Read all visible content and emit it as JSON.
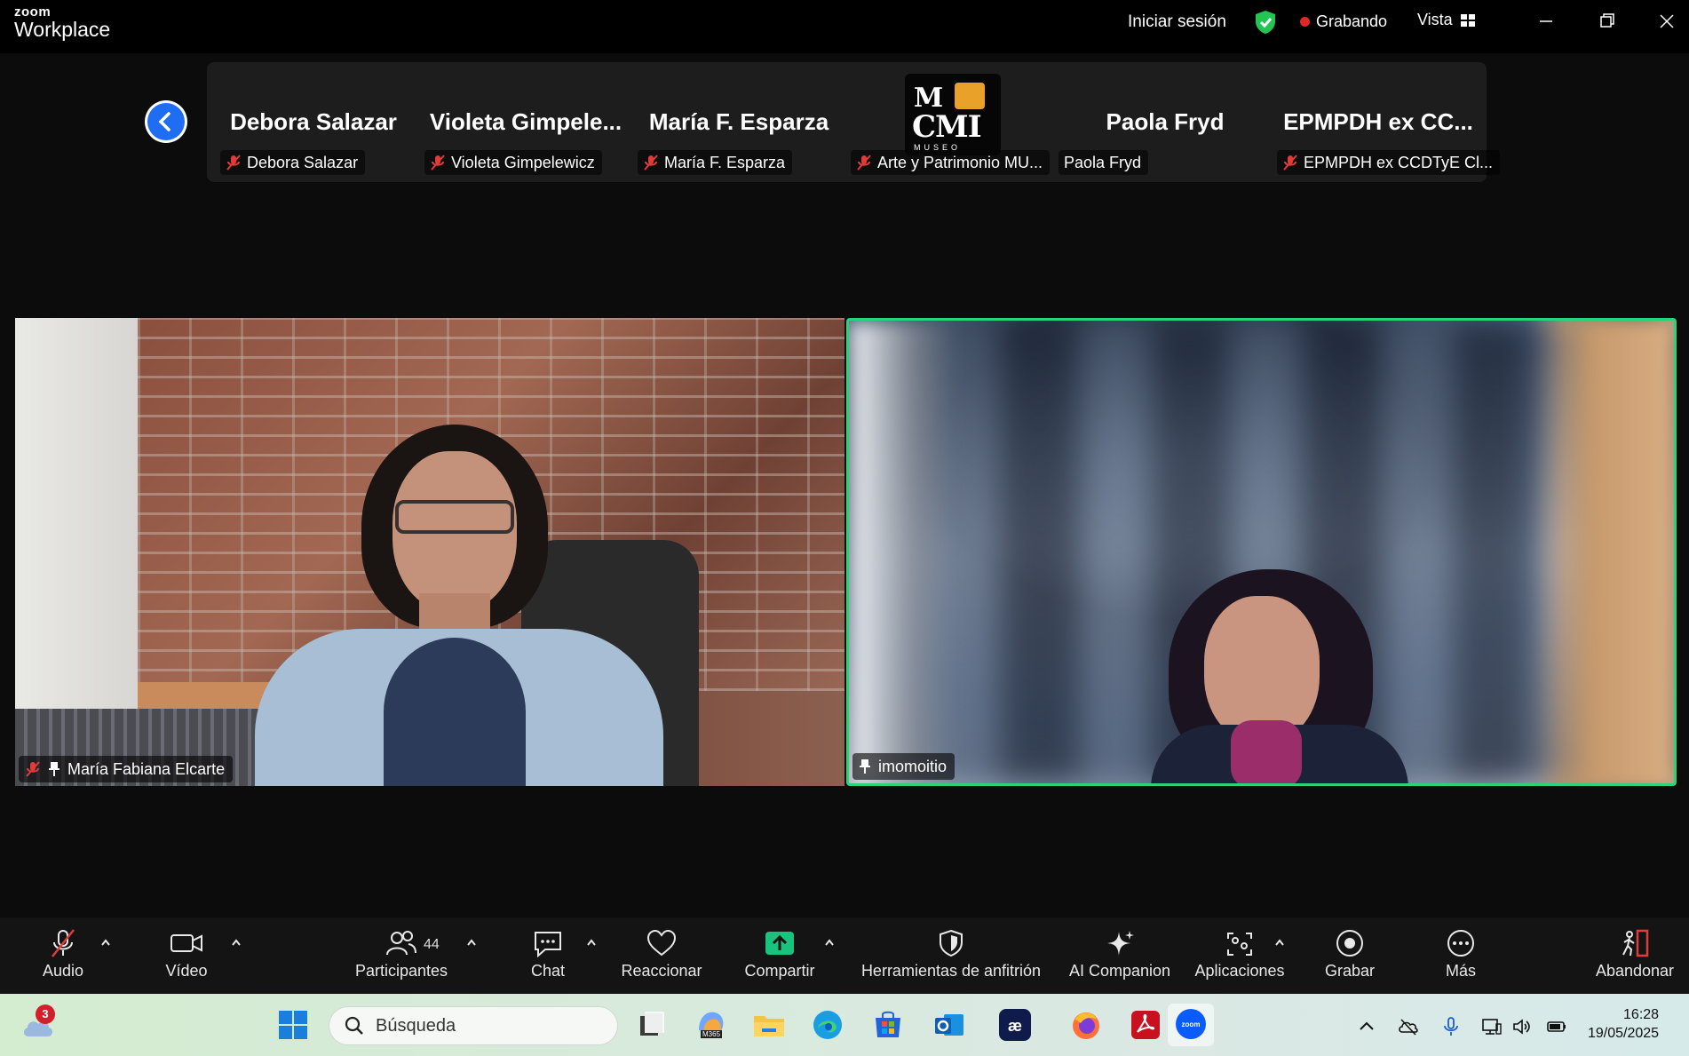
{
  "app": {
    "brand_small": "zoom",
    "brand_large": "Workplace"
  },
  "titlebar": {
    "signin": "Iniciar sesión",
    "recording": "Grabando",
    "view": "Vista"
  },
  "strip": {
    "tiles": [
      {
        "bigname": "Debora Salazar",
        "label": "Debora Salazar",
        "muted": true
      },
      {
        "bigname": "Violeta  Gimpele...",
        "label": "Violeta Gimpelewicz",
        "muted": true
      },
      {
        "bigname": "María F. Esparza",
        "label": "María F. Esparza",
        "muted": true
      },
      {
        "bigname": "",
        "label": "Arte y Patrimonio MU...",
        "muted": true
      },
      {
        "bigname": "Paola Fryd",
        "label": "Paola Fryd",
        "muted": false
      },
      {
        "bigname": "EPMPDH  ex  CC...",
        "label": "EPMPDH ex CCDTyE Cl...",
        "muted": true
      }
    ],
    "logo_tile": {
      "line1": "M",
      "line2": "CMI",
      "line3": "MUSEO"
    }
  },
  "videos": {
    "left": {
      "name": "María Fabiana Elcarte"
    },
    "right": {
      "name": "imomoitio"
    }
  },
  "toolbar": {
    "audio": "Audio",
    "video": "Vídeo",
    "participants": "Participantes",
    "participants_count": "44",
    "chat": "Chat",
    "react": "Reaccionar",
    "share": "Compartir",
    "host_tools": "Herramientas de anfitrión",
    "ai": "AI Companion",
    "apps": "Aplicaciones",
    "record": "Grabar",
    "more": "Más",
    "leave": "Abandonar"
  },
  "taskbar": {
    "search_placeholder": "Búsqueda",
    "weather_badge": "3",
    "time": "16:28",
    "date": "19/05/2025",
    "m365": "M365"
  },
  "colors": {
    "accent_green": "#27d47a",
    "record_red": "#e02828",
    "blue": "#1e6df2",
    "share_green": "#19c37d"
  }
}
